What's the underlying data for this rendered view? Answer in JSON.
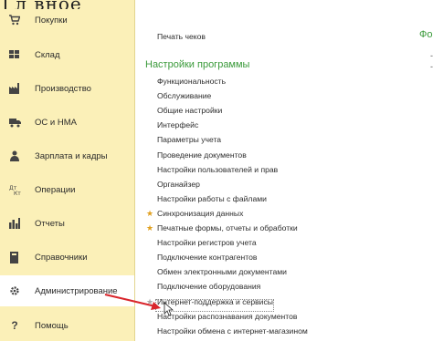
{
  "sidebar": {
    "top_partial": "Гл   вное",
    "items": [
      {
        "label": "Покупки",
        "icon": "shopping-cart-icon"
      },
      {
        "label": "Склад",
        "icon": "warehouse-icon"
      },
      {
        "label": "Производство",
        "icon": "factory-icon"
      },
      {
        "label": "ОС и НМА",
        "icon": "truck-icon"
      },
      {
        "label": "Зарплата и кадры",
        "icon": "person-icon"
      },
      {
        "label": "Операции",
        "icon": "operations-icon"
      },
      {
        "label": "Отчеты",
        "icon": "bar-chart-icon"
      },
      {
        "label": "Справочники",
        "icon": "book-icon"
      },
      {
        "label": "Администрирование",
        "icon": "gear-icon"
      },
      {
        "label": "Помощь",
        "icon": "help-icon"
      }
    ],
    "active_index": 8
  },
  "main": {
    "top_link": "Печать чеков",
    "right_title": "Форм",
    "section_title": "Настройки программы",
    "links": [
      {
        "label": "Функциональность",
        "starred": false
      },
      {
        "label": "Обслуживание",
        "starred": false
      },
      {
        "label": "Общие настройки",
        "starred": false
      },
      {
        "label": "Интерфейс",
        "starred": false
      },
      {
        "label": "Параметры учета",
        "starred": false
      },
      {
        "label": "Проведение документов",
        "starred": false
      },
      {
        "label": "Настройки пользователей и прав",
        "starred": false
      },
      {
        "label": "Органайзер",
        "starred": false
      },
      {
        "label": "Настройки работы с файлами",
        "starred": false
      },
      {
        "label": "Синхронизация данных",
        "starred": true
      },
      {
        "label": "Печатные формы, отчеты и обработки",
        "starred": true
      },
      {
        "label": "Настройки регистров учета",
        "starred": false
      },
      {
        "label": "Подключение контрагентов",
        "starred": false
      },
      {
        "label": "Обмен электронными документами",
        "starred": false
      },
      {
        "label": "Подключение оборудования",
        "starred": false
      },
      {
        "label": "Интернет-поддержка и сервисы",
        "starred": true
      },
      {
        "label": "Настройки распознавания документов",
        "starred": false
      },
      {
        "label": "Настройки обмена с интернет-магазином",
        "starred": false
      }
    ]
  },
  "colors": {
    "sidebar_bg": "#fbf0b8",
    "section_title": "#3a9a3a",
    "arrow": "#d9262c",
    "star": "#e0a020"
  }
}
